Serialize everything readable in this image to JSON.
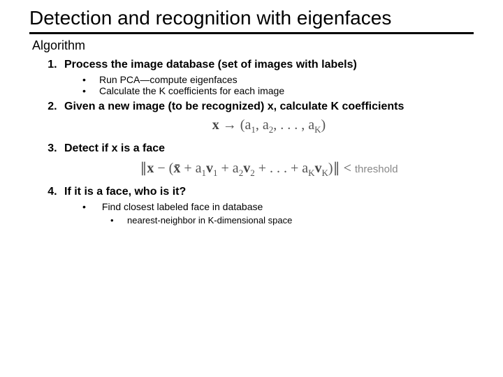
{
  "title": "Detection and recognition with eigenfaces",
  "subtitle": "Algorithm",
  "steps": {
    "s1": {
      "text": "Process the image database (set of images with labels)",
      "bullets": {
        "b1": "Run PCA—compute eigenfaces",
        "b2": "Calculate the K coefficients for each image"
      }
    },
    "s2": {
      "text": "Given a new image (to be recognized) x, calculate K coefficients"
    },
    "s3": {
      "text": "Detect if x is a face"
    },
    "s4": {
      "text": "If it is a face, who is it?",
      "bullets": {
        "b1": "Find closest labeled face in database",
        "sub": {
          "b1": "nearest-neighbor in K-dimensional space"
        }
      }
    }
  },
  "formulas": {
    "f1_parts": {
      "x": "x",
      "arrow": " → (",
      "a": "a",
      "s1": "1",
      "c": ", ",
      "s2": "2",
      "dots": ", . . . , ",
      "sK": "K",
      "close": ")"
    },
    "f2_parts": {
      "open": "∥",
      "x": "x",
      "minus": " − (",
      "xbar": "x̄",
      "plus": " + ",
      "a": "a",
      "v": "v",
      "s1": "1",
      "s2": "2",
      "dots": " + . . . + ",
      "sK": "K",
      "close": ")∥ < ",
      "threshold": "threshold"
    }
  }
}
